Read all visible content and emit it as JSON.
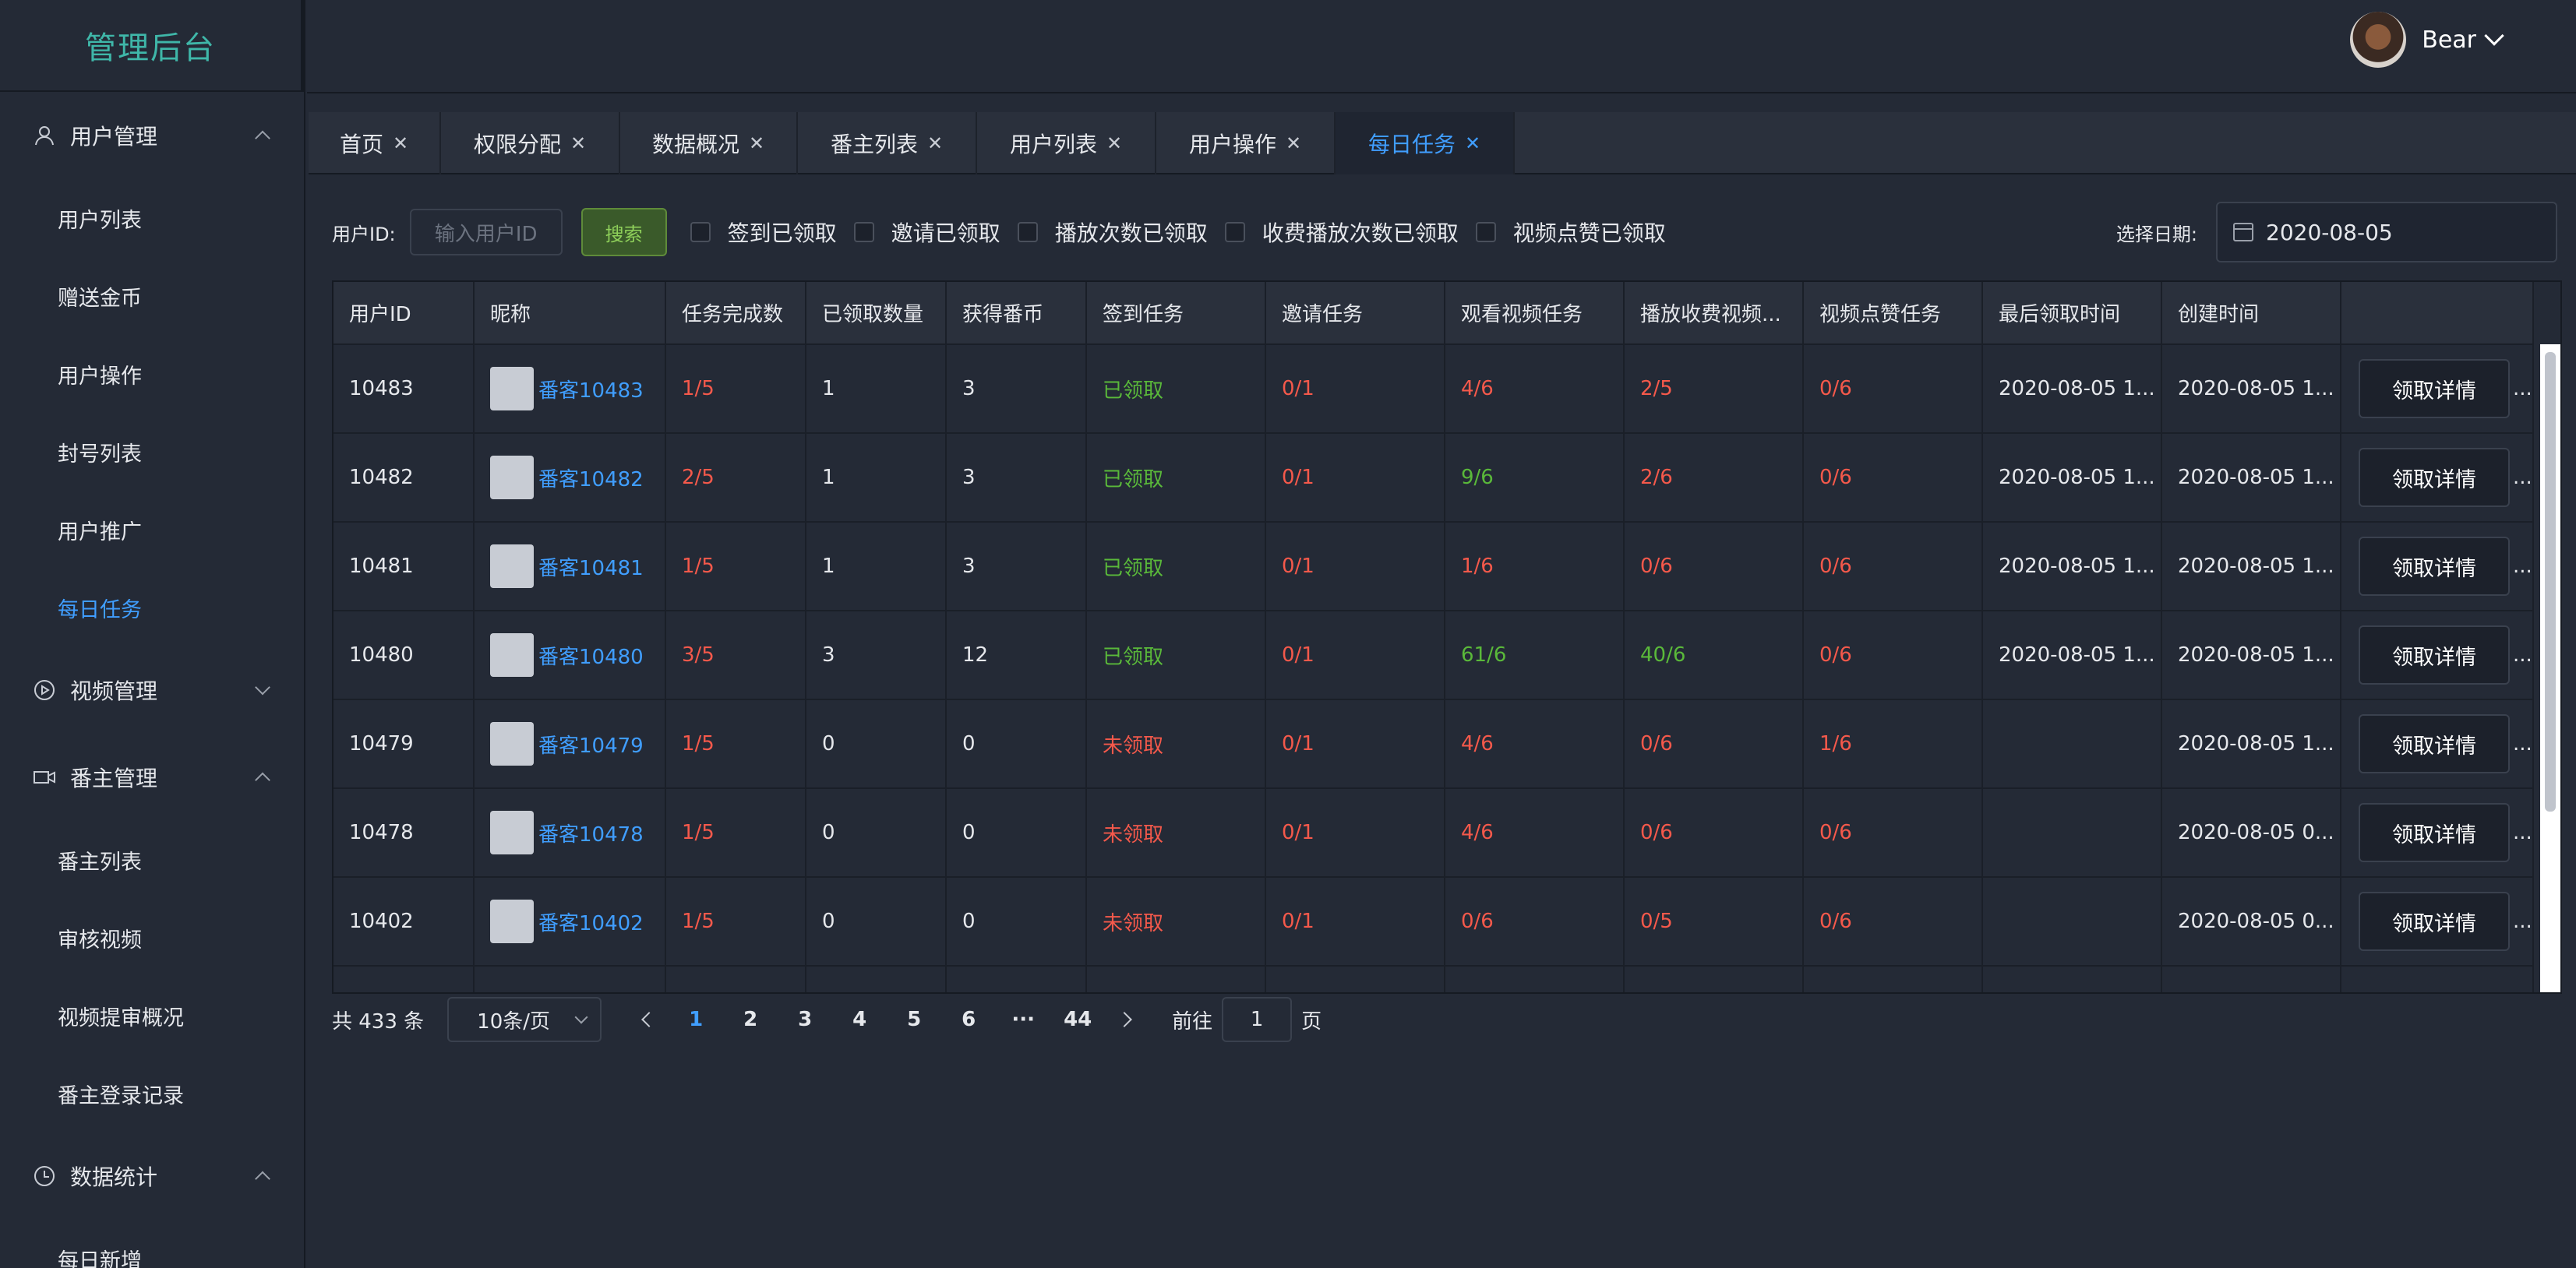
{
  "app": {
    "logo": "管理后台"
  },
  "header": {
    "user_name": "Bear"
  },
  "sidebar": {
    "groups": [
      {
        "label": "用户管理",
        "icon": "user-icon",
        "expanded": true,
        "items": [
          {
            "label": "用户列表",
            "active": false
          },
          {
            "label": "赠送金币",
            "active": false
          },
          {
            "label": "用户操作",
            "active": false
          },
          {
            "label": "封号列表",
            "active": false
          },
          {
            "label": "用户推广",
            "active": false
          },
          {
            "label": "每日任务",
            "active": true
          }
        ]
      },
      {
        "label": "视频管理",
        "icon": "play-circle-icon",
        "expanded": false,
        "items": []
      },
      {
        "label": "番主管理",
        "icon": "video-camera-icon",
        "expanded": true,
        "items": [
          {
            "label": "番主列表"
          },
          {
            "label": "审核视频"
          },
          {
            "label": "视频提审概况"
          },
          {
            "label": "番主登录记录"
          }
        ]
      },
      {
        "label": "数据统计",
        "icon": "clock-icon",
        "expanded": true,
        "items": [
          {
            "label": "每日新增"
          }
        ]
      }
    ]
  },
  "tabs": [
    {
      "label": "首页",
      "active": false
    },
    {
      "label": "权限分配",
      "active": false
    },
    {
      "label": "数据概况",
      "active": false
    },
    {
      "label": "番主列表",
      "active": false
    },
    {
      "label": "用户列表",
      "active": false
    },
    {
      "label": "用户操作",
      "active": false
    },
    {
      "label": "每日任务",
      "active": true
    }
  ],
  "filter": {
    "user_id_label": "用户ID:",
    "user_id_placeholder": "输入用户ID",
    "search_button": "搜索",
    "checkboxes": [
      "签到已领取",
      "邀请已领取",
      "播放次数已领取",
      "收费播放次数已领取",
      "视频点赞已领取"
    ],
    "date_label": "选择日期:",
    "date_value": "2020-08-05"
  },
  "table": {
    "columns": [
      "用户ID",
      "昵称",
      "任务完成数",
      "已领取数量",
      "获得番币",
      "签到任务",
      "邀请任务",
      "观看视频任务",
      "播放收费视频...",
      "视频点赞任务",
      "最后领取时间",
      "创建时间",
      ""
    ],
    "detail_button": "领取详情",
    "more": "...",
    "rows": [
      {
        "id": "10483",
        "nick": "番客10483",
        "done": "1/5",
        "claimed": "1",
        "coins": "3",
        "checkin": "已领取",
        "invite": "0/1",
        "watch": "4/6",
        "paid": "2/5",
        "like": "0/6",
        "last": "2020-08-05 1...",
        "created": "2020-08-05 1..."
      },
      {
        "id": "10482",
        "nick": "番客10482",
        "done": "2/5",
        "claimed": "1",
        "coins": "3",
        "checkin": "已领取",
        "invite": "0/1",
        "watch": "9/6",
        "paid": "2/6",
        "like": "0/6",
        "last": "2020-08-05 1...",
        "created": "2020-08-05 1..."
      },
      {
        "id": "10481",
        "nick": "番客10481",
        "done": "1/5",
        "claimed": "1",
        "coins": "3",
        "checkin": "已领取",
        "invite": "0/1",
        "watch": "1/6",
        "paid": "0/6",
        "like": "0/6",
        "last": "2020-08-05 1...",
        "created": "2020-08-05 1..."
      },
      {
        "id": "10480",
        "nick": "番客10480",
        "done": "3/5",
        "claimed": "3",
        "coins": "12",
        "checkin": "已领取",
        "invite": "0/1",
        "watch": "61/6",
        "paid": "40/6",
        "like": "0/6",
        "last": "2020-08-05 1...",
        "created": "2020-08-05 1..."
      },
      {
        "id": "10479",
        "nick": "番客10479",
        "done": "1/5",
        "claimed": "0",
        "coins": "0",
        "checkin": "未领取",
        "invite": "0/1",
        "watch": "4/6",
        "paid": "0/6",
        "like": "1/6",
        "last": "",
        "created": "2020-08-05 1..."
      },
      {
        "id": "10478",
        "nick": "番客10478",
        "done": "1/5",
        "claimed": "0",
        "coins": "0",
        "checkin": "未领取",
        "invite": "0/1",
        "watch": "4/6",
        "paid": "0/6",
        "like": "0/6",
        "last": "",
        "created": "2020-08-05 0..."
      },
      {
        "id": "10402",
        "nick": "番客10402",
        "done": "1/5",
        "claimed": "0",
        "coins": "0",
        "checkin": "未领取",
        "invite": "0/1",
        "watch": "0/6",
        "paid": "0/5",
        "like": "0/6",
        "last": "",
        "created": "2020-08-05 0..."
      }
    ]
  },
  "pagination": {
    "total": "共 433 条",
    "page_size": "10条/页",
    "pages": [
      "1",
      "2",
      "3",
      "4",
      "5",
      "6",
      "···",
      "44"
    ],
    "current": "1",
    "goto_label": "前往",
    "goto_value": "1",
    "goto_suffix": "页"
  },
  "colors": {
    "accent": "#409eff",
    "danger": "#f5594b",
    "success": "#5ab93a",
    "logo": "#3fb7a9"
  }
}
